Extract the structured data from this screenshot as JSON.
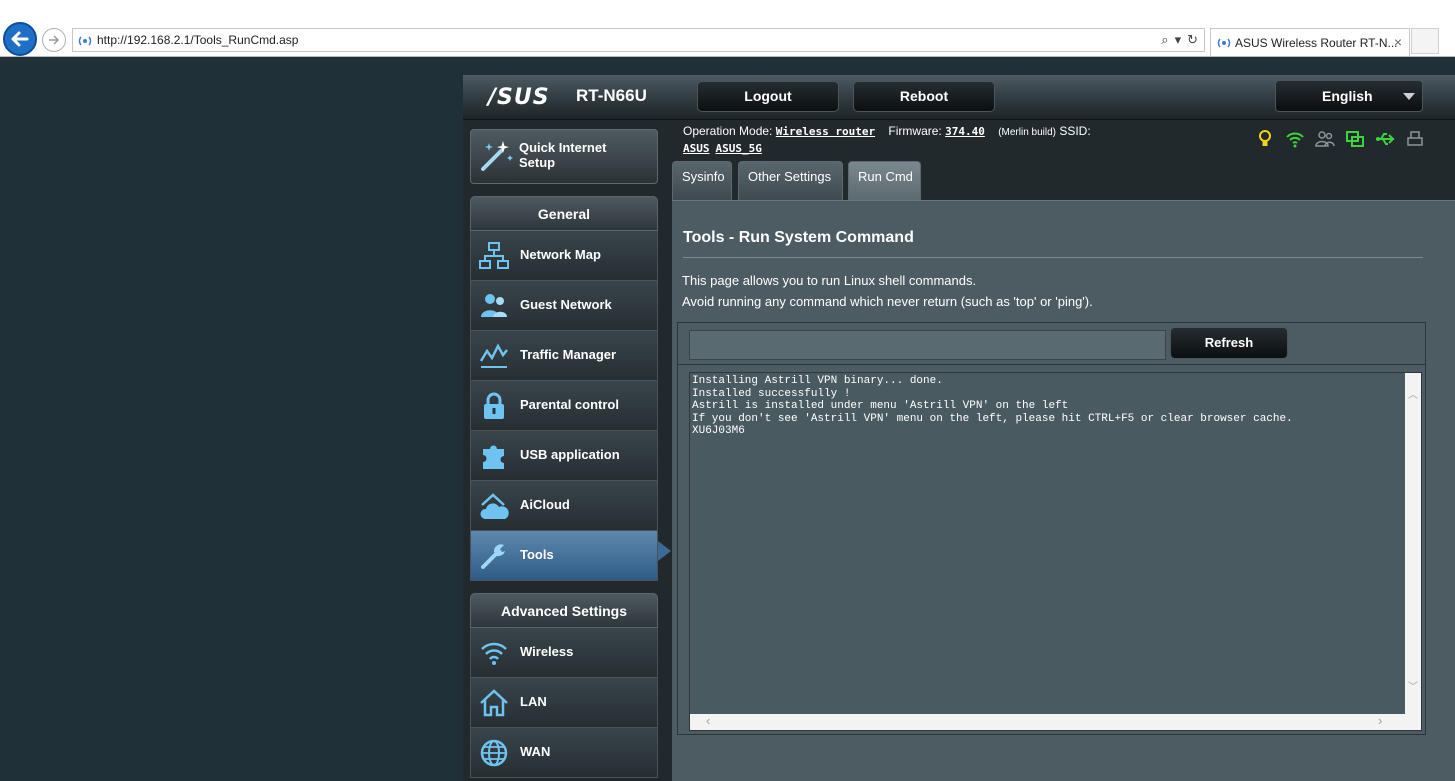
{
  "browser": {
    "url": "http://192.168.2.1/Tools_RunCmd.asp",
    "tab_title": "ASUS Wireless Router RT-N...",
    "tab_close": "×"
  },
  "router": {
    "brand": "/SUS",
    "model": "RT-N66U",
    "logout_label": "Logout",
    "reboot_label": "Reboot",
    "language": "English"
  },
  "status": {
    "op_mode_label": "Operation Mode:",
    "op_mode_value": "Wireless router",
    "firmware_label": "Firmware:",
    "firmware_value": "374.40",
    "build_note": "(Merlin build)",
    "ssid_label": "SSID:",
    "ssids": [
      "ASUS",
      "ASUS_5G"
    ]
  },
  "sidebar": {
    "qis_label": "Quick Internet Setup",
    "general_header": "General",
    "general_items": [
      {
        "label": "Network Map",
        "icon": "network-map-icon"
      },
      {
        "label": "Guest Network",
        "icon": "guest-network-icon"
      },
      {
        "label": "Traffic Manager",
        "icon": "traffic-manager-icon"
      },
      {
        "label": "Parental control",
        "icon": "lock-icon"
      },
      {
        "label": "USB application",
        "icon": "puzzle-icon"
      },
      {
        "label": "AiCloud",
        "icon": "cloud-house-icon"
      },
      {
        "label": "Tools",
        "icon": "wrench-icon"
      }
    ],
    "active_item": "Tools",
    "advanced_header": "Advanced Settings",
    "advanced_items": [
      {
        "label": "Wireless",
        "icon": "wifi-icon"
      },
      {
        "label": "LAN",
        "icon": "house-icon"
      },
      {
        "label": "WAN",
        "icon": "globe-icon"
      }
    ]
  },
  "tabs": [
    {
      "label": "Sysinfo",
      "active": false
    },
    {
      "label": "Other Settings",
      "active": false
    },
    {
      "label": "Run Cmd",
      "active": true
    }
  ],
  "main": {
    "title": "Tools - Run System Command",
    "desc_line1": "This page allows you to run Linux shell commands.",
    "desc_line2": "Avoid running any command which never return (such as 'top' or 'ping').",
    "command_value": "",
    "refresh_label": "Refresh",
    "output": "Installing Astrill VPN binary... done.\nInstalled successfully !\nAstrill is installed under menu 'Astrill VPN' on the left\nIf you don't see 'Astrill VPN' menu on the left, please hit CTRL+F5 or clear browser cache.\nXU6J03M6"
  },
  "colors": {
    "accent_blue": "#3d6a95",
    "status_yellow": "#f5d21a",
    "status_green": "#3ed23e"
  }
}
